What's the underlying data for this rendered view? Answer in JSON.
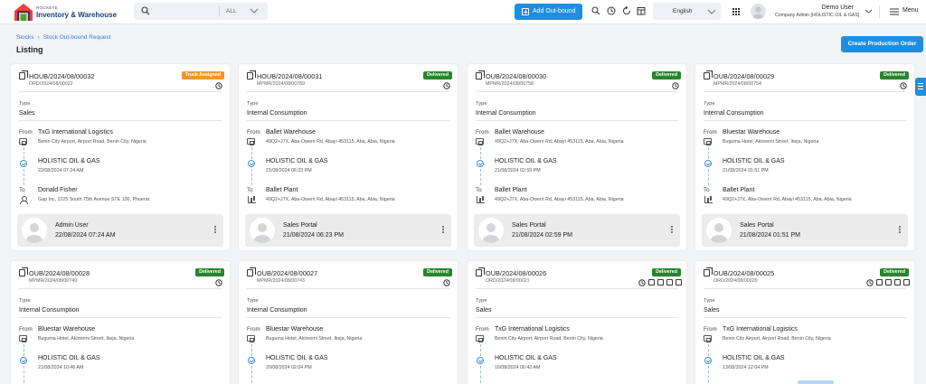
{
  "app": {
    "brand_small": "ROCKEYE",
    "brand": "Inventory & Warehouse"
  },
  "search": {
    "scope": "ALL"
  },
  "header": {
    "add_button": "Add Out-bound",
    "language": "English",
    "user_name": "Demo User",
    "user_role": "Company Admin [HOLISTIC OIL & GAS]",
    "menu_label": "Menu"
  },
  "breadcrumb": {
    "items": [
      "Stocks",
      "Stock Out-bound Request"
    ]
  },
  "page": {
    "title": "Listing",
    "create_button": "Create Production Order"
  },
  "labels": {
    "type": "Type",
    "from": "From",
    "to": "To"
  },
  "colors": {
    "accent": "#1e8fe0",
    "delivered": "#27862b",
    "truck_assigned": "#f0962f"
  },
  "cards": [
    {
      "id": "HOUB/2024/08/00032",
      "ref": "ORD/2024/08/00022",
      "status": "Truck Assigned",
      "type": "Sales",
      "from_name": "TxG International Logistics",
      "from_addr": "Benin City Airport, Airport Road, Benin City, Nigeria",
      "mid_name": "HOLISTIC OIL & GAS",
      "mid_date": "22/08/2024 07:24 AM",
      "to_name": "Donald Fisher",
      "to_addr": "Gap Inc, 2225 South 75th Avenue STE 100, Phoenix",
      "user": "Admin User",
      "user_date": "22/08/2024 07:24 AM"
    },
    {
      "id": "HOUB/2024/08/00031",
      "ref": "MPMR/2024/08/00769",
      "status": "Delivered",
      "type": "Internal Consumption",
      "from_name": "Ballet Warehouse",
      "from_addr": "49Q2+J7X, Aba-Owerri Rd, Abayi 453115, Aba, Abia, Nigeria",
      "mid_name": "HOLISTIC OIL & GAS",
      "mid_date": "21/08/2024 06:23 PM",
      "to_name": "Ballet Plant",
      "to_addr": "49Q2+J7X, Aba-Owerri Rd, Abayi 453115, Aba, Abia, Nigeria",
      "user": "Sales Portal",
      "user_date": "21/08/2024 06:23 PM"
    },
    {
      "id": "OUB/2024/08/00030",
      "ref": "MPMR/2024/08/00758",
      "status": "Delivered",
      "type": "Internal Consumption",
      "from_name": "Ballet Warehouse",
      "from_addr": "49Q2+J7X, Aba-Owerri Rd, Abayi 453115, Aba, Abia, Nigeria",
      "mid_name": "HOLISTIC OIL & GAS",
      "mid_date": "21/08/2024 02:59 PM",
      "to_name": "Ballet Plant",
      "to_addr": "49Q2+J7X, Aba-Owerri Rd, Abayi 453115, Aba, Abia, Nigeria",
      "user": "Sales Portal",
      "user_date": "21/08/2024 02:59 PM"
    },
    {
      "id": "OUB/2024/08/00029",
      "ref": "MPMR/2024/08/00754",
      "status": "Delivered",
      "type": "Internal Consumption",
      "from_name": "Bluestar Warehouse",
      "from_addr": "Buguma Hotel, Akinremi Street, Ikeja, Nigeria",
      "mid_name": "HOLISTIC OIL & GAS",
      "mid_date": "21/08/2024 01:51 PM",
      "to_name": "Ballet Plant",
      "to_addr": "49Q2+J7X, Aba-Owerri Rd, Abayi 453115, Aba, Abia, Nigeria",
      "user": "Sales Portal",
      "user_date": "21/08/2024 01:51 PM"
    },
    {
      "id": "OUB/2024/08/00028",
      "ref": "MPMR/2024/08/00749",
      "status": "Delivered",
      "type": "Internal Consumption",
      "from_name": "Bluestar Warehouse",
      "from_addr": "Buguma Hotel, Akinremi Street, Ikeja, Nigeria",
      "mid_name": "HOLISTIC OIL & GAS",
      "mid_date": "21/08/2024 10:46 AM"
    },
    {
      "id": "OUB/2024/08/00027",
      "ref": "MPMR/2024/08/00743",
      "status": "Delivered",
      "type": "Internal Consumption",
      "from_name": "Bluestar Warehouse",
      "from_addr": "Buguma Hotel, Akinremi Street, Ikeja, Nigeria",
      "mid_name": "HOLISTIC OIL & GAS",
      "mid_date": "20/08/2024 02:04 PM"
    },
    {
      "id": "OUB/2024/08/00026",
      "ref": "ORD/2024/08/00021",
      "status": "Delivered",
      "type": "Sales",
      "from_name": "TxG International Logistics",
      "from_addr": "Benin City Airport, Airport Road, Benin City, Nigeria",
      "mid_name": "HOLISTIC OIL & GAS",
      "mid_date": "16/08/2024 06:42 AM"
    },
    {
      "id": "OUB/2024/08/00025",
      "ref": "ORD/2024/08/00020",
      "status": "Delivered",
      "type": "Sales",
      "from_name": "TxG International Logistics",
      "from_addr": "Benin City Airport, Airport Road, Benin City, Nigeria",
      "mid_name": "HOLISTIC OIL & GAS",
      "mid_date": "13/08/2024 12:04 PM"
    }
  ]
}
